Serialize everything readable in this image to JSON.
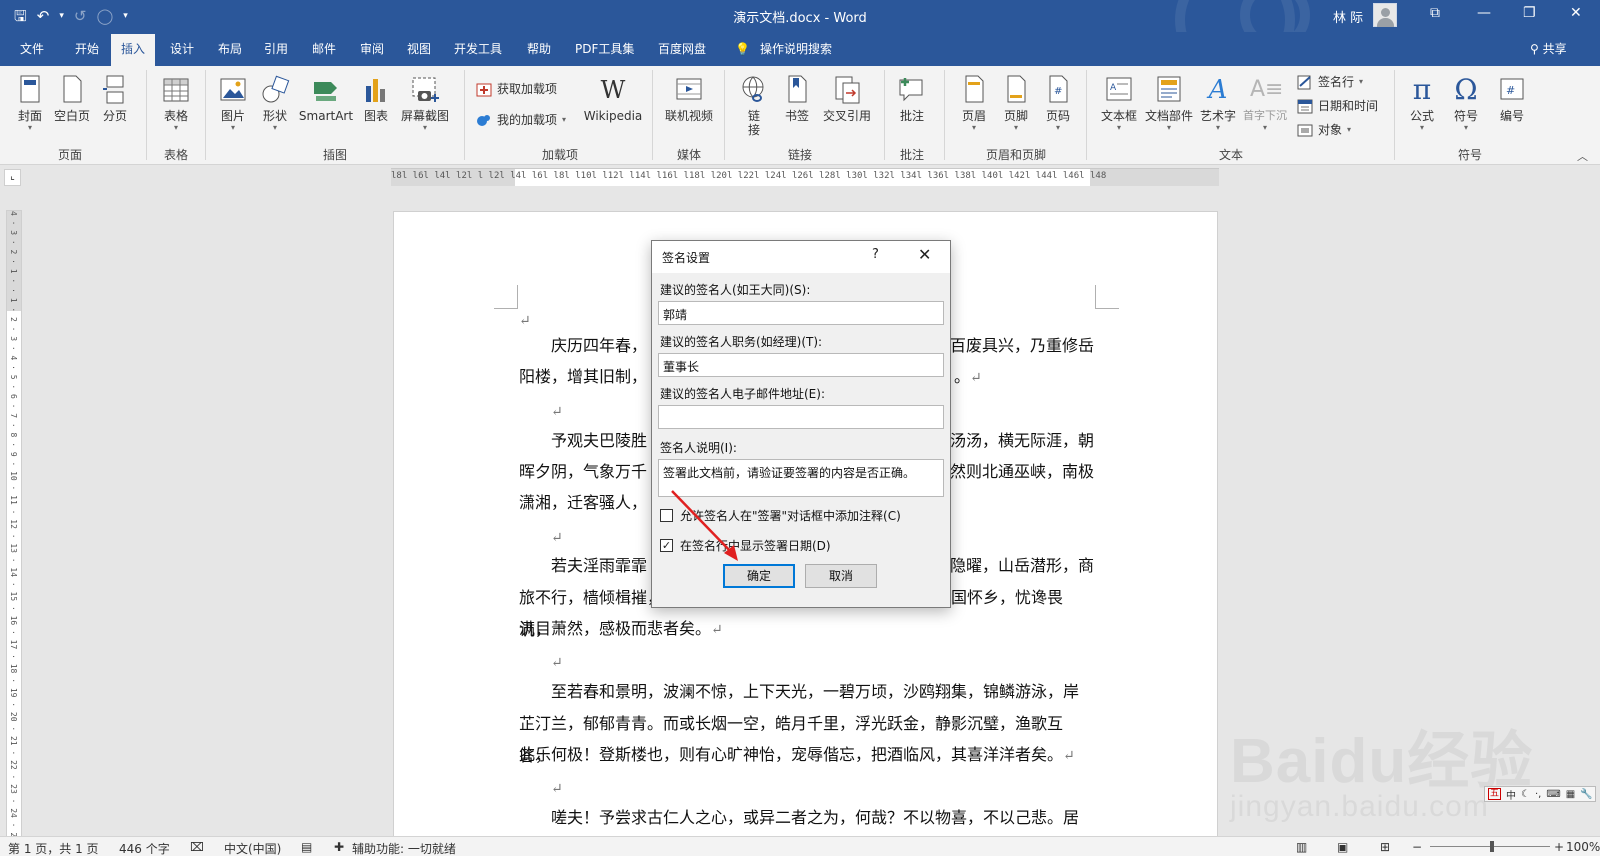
{
  "titlebar": {
    "doc_title": "演示文档.docx - Word",
    "user": "林 际",
    "qat": {
      "save": "🖫",
      "undo": "↶",
      "undo_arrow": "▾",
      "redo": "↺",
      "circle": "◯",
      "customize": "▾"
    },
    "win": {
      "ribbon_options": "⧉",
      "minimize": "—",
      "restore": "❐",
      "close": "✕"
    }
  },
  "tabs": [
    {
      "label": "文件"
    },
    {
      "label": "开始"
    },
    {
      "label": "插入"
    },
    {
      "label": "设计"
    },
    {
      "label": "布局"
    },
    {
      "label": "引用"
    },
    {
      "label": "邮件"
    },
    {
      "label": "审阅"
    },
    {
      "label": "视图"
    },
    {
      "label": "开发工具"
    },
    {
      "label": "帮助"
    },
    {
      "label": "PDF工具集"
    },
    {
      "label": "百度网盘"
    },
    {
      "label": "操作说明搜索"
    }
  ],
  "active_tab": "插入",
  "share_label": "共享",
  "ribbon": {
    "buttons": {
      "cover": "封面",
      "blank": "空白页",
      "break": "分页",
      "table": "表格",
      "picture": "图片",
      "shapes": "形状",
      "smartart": "SmartArt",
      "chart": "图表",
      "screenshot": "屏幕截图",
      "get_addins": "获取加载项",
      "my_addins": "我的加载项",
      "wikipedia": "Wikipedia",
      "online_video": "联机视频",
      "link_line1": "链",
      "link_line2": "接",
      "bookmark": "书签",
      "cross_ref": "交叉引用",
      "comment": "批注",
      "header": "页眉",
      "footer": "页脚",
      "page_number": "页码",
      "textbox": "文本框",
      "quick_parts": "文档部件",
      "wordart": "艺术字",
      "dropcap": "首字下沉",
      "signature_line": "签名行",
      "date_time": "日期和时间",
      "object": "对象",
      "equation": "公式",
      "symbol": "符号",
      "numbering": "编号"
    },
    "groups": {
      "pages": "页面",
      "tables": "表格",
      "illustrations": "插图",
      "addins": "加载项",
      "media": "媒体",
      "links": "链接",
      "comments": "批注",
      "header_footer": "页眉和页脚",
      "text": "文本",
      "symbols": "符号"
    },
    "accent": "#2b579a"
  },
  "ruler": {
    "h_numbers": "l8l l6l l4l l2l l   l2l l4l l6l l8l l10l l12l l14l l16l l18l l20l l22l l24l l26l l28l l30l l32l l34l l36l l38l  l40l l42l l44l l46l l48",
    "v_numbers": "4 · 3 · 2 · 1 ·   · 1 · 2 · 3 · 4 · 5 · 6 · 7 · 8 · 9 · 10 · 11 · 12 · 13 · 14 · 15 · 16 · 17 · 18 · 19 · 20 · 21 · 22 · 23 · 24 · 25"
  },
  "document": {
    "return_mark": "↵",
    "p1_line1_left": "庆历四年春，",
    "p1_line1_right": "百废具兴，乃重修岳",
    "p1_line2_left": "阳楼，增其旧制，",
    "p1_line2_right": "。",
    "p2_line1_left": "予观夫巴陵胜",
    "p2_line1_right": "汤汤，横无际涯，朝",
    "p2_line2_left": "晖夕阴，气象万千",
    "p2_line2_right": "然则北通巫峡，南极",
    "p2_line3_left": "潇湘，迁客骚人，",
    "p3_line1_left": "若夫淫雨霏霏",
    "p3_line1_right": "隐曜，山岳潜形，商",
    "p3_line2": "旅不行，樯倾楫摧，薄暮冥冥，虎啸猿啼。登斯楼也，则有去国怀乡，忧谗畏讥，",
    "p3_line3": "满目萧然，感极而悲者矣。",
    "p4_line1": "至若春和景明，波澜不惊，上下天光，一碧万顷，沙鸥翔集，锦鳞游泳，岸",
    "p4_line2": "芷汀兰，郁郁青青。而或长烟一空，皓月千里，浮光跃金，静影沉璧，渔歌互答，",
    "p4_line3": "此乐何极！登斯楼也，则有心旷神怡，宠辱偕忘，把酒临风，其喜洋洋者矣。",
    "p5_line1": "嗟夫！予尝求古仁人之心，或异二者之为，何哉？不以物喜，不以己悲。居"
  },
  "dialog": {
    "title": "签名设置",
    "help": "?",
    "close": "✕",
    "signer_label": "建议的签名人(如王大同)(S):",
    "signer_value": "郭靖",
    "title_label": "建议的签名人职务(如经理)(T):",
    "title_value": "董事长",
    "email_label": "建议的签名人电子邮件地址(E):",
    "email_value": "",
    "instructions_label": "签名人说明(I):",
    "instructions_value": "签署此文档前，请验证要签署的内容是否正确。",
    "allow_comments_label": "允许签名人在\"签署\"对话框中添加注释(C)",
    "allow_comments_checked": "",
    "show_date_label": "在签名行中显示签署日期(D)",
    "show_date_checked": "✓",
    "ok": "确定",
    "cancel": "取消"
  },
  "statusbar": {
    "page": "第 1 页，共 1 页",
    "words": "446 个字",
    "language": "中文(中国)",
    "accessibility": "辅助功能: 一切就绪",
    "zoom": "100%"
  },
  "ime": {
    "label": "中"
  },
  "watermark": {
    "brand": "Baidu经验",
    "url": "jingyan.baidu.com"
  }
}
